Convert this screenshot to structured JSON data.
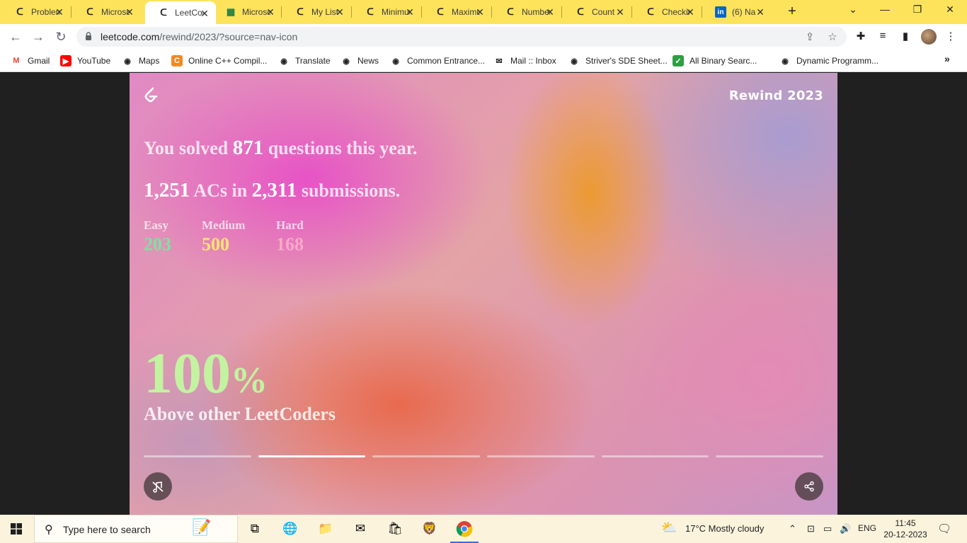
{
  "browser": {
    "tabs": [
      {
        "title": "Problems",
        "favicon": "leetcode-icon"
      },
      {
        "title": "Microsoft",
        "favicon": "leetcode-icon"
      },
      {
        "title": "LeetCode",
        "favicon": "leetcode-icon",
        "active": true
      },
      {
        "title": "Microsoft",
        "favicon": "sheet-icon"
      },
      {
        "title": "My List",
        "favicon": "leetcode-icon"
      },
      {
        "title": "Minimum",
        "favicon": "leetcode-icon"
      },
      {
        "title": "Maximum",
        "favicon": "leetcode-icon"
      },
      {
        "title": "Number",
        "favicon": "leetcode-icon"
      },
      {
        "title": "Count",
        "favicon": "leetcode-icon"
      },
      {
        "title": "Checking",
        "favicon": "leetcode-icon"
      },
      {
        "title": "(6) Na",
        "favicon": "linkedin-icon"
      }
    ],
    "url_host": "leetcode.com",
    "url_path": "/rewind/2023/?source=nav-icon",
    "bookmarks": [
      {
        "label": "Gmail",
        "icon": "gmail-icon"
      },
      {
        "label": "YouTube",
        "icon": "youtube-icon"
      },
      {
        "label": "Maps",
        "icon": "globe-icon"
      },
      {
        "label": "Online C++ Compil...",
        "icon": "code-icon"
      },
      {
        "label": "Translate",
        "icon": "globe-icon"
      },
      {
        "label": "News",
        "icon": "globe-icon"
      },
      {
        "label": "Common Entrance...",
        "icon": "globe-icon"
      },
      {
        "label": "Mail :: Inbox",
        "icon": "mail-icon"
      },
      {
        "label": "Striver's SDE Sheet...",
        "icon": "globe-icon"
      },
      {
        "label": "All Binary Searc...",
        "icon": "check-icon"
      },
      {
        "label": "Dynamic Programm...",
        "icon": "globe-icon"
      }
    ]
  },
  "rewind": {
    "badge": "Rewind 2023",
    "solved_prefix": "You solved ",
    "solved_count": "871",
    "solved_suffix": " questions this year.",
    "ac_count": "1,251",
    "ac_mid": " ACs in ",
    "submission_count": "2,311",
    "submission_suffix": " submissions.",
    "difficulties": [
      {
        "label": "Easy",
        "value": "203",
        "color": "#7ee2a0"
      },
      {
        "label": "Medium",
        "value": "500",
        "color": "#ffe36e"
      },
      {
        "label": "Hard",
        "value": "168",
        "color": "#f7a9c9"
      }
    ],
    "percentile_number": "100",
    "percentile_sign": "%",
    "percentile_caption": "Above other LeetCoders",
    "progress": {
      "segments": 6,
      "active_index": 1
    },
    "accent": "#c3f3a0"
  },
  "taskbar": {
    "search_placeholder": "Type here to search",
    "weather": "17°C  Mostly cloudy",
    "language": "ENG",
    "time": "11:45",
    "date": "20-12-2023"
  }
}
